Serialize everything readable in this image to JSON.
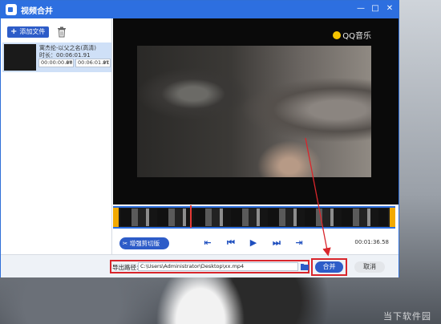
{
  "window": {
    "title": "视频合并",
    "minimize_label": "—",
    "maximize_label": "□",
    "close_label": "✕"
  },
  "toolbar": {
    "add_file_label": "添加文件",
    "add_icon": "plus-icon",
    "delete_icon": "trash-icon"
  },
  "file_list": [
    {
      "name": "寓杰伦-以父之名(高清)",
      "duration": "时长：00:06:01.91",
      "start_time": "00:00:00.00",
      "end_time": "00:06:01.91"
    }
  ],
  "video": {
    "watermark_logo": "QQ音乐"
  },
  "controls": {
    "enhance_cut_label": "增强剪切版",
    "time_readout": "00:01:36.58",
    "buttons": [
      "skip-to-start-icon",
      "prev-frame-icon",
      "play-icon",
      "next-frame-icon",
      "skip-to-end-icon"
    ]
  },
  "export": {
    "label": "导出路径：",
    "path": "C:\\Users\\Administrator\\Desktop\\xx.mp4"
  },
  "actions": {
    "merge_label": "合并",
    "cancel_label": "取消"
  },
  "desktop": {
    "watermark": "当下软件园"
  },
  "colors": {
    "accent": "#2d6fe0",
    "button_blue": "#2d5cc8",
    "highlight_red": "#d9262c",
    "timeline_handle": "#f2a900"
  }
}
